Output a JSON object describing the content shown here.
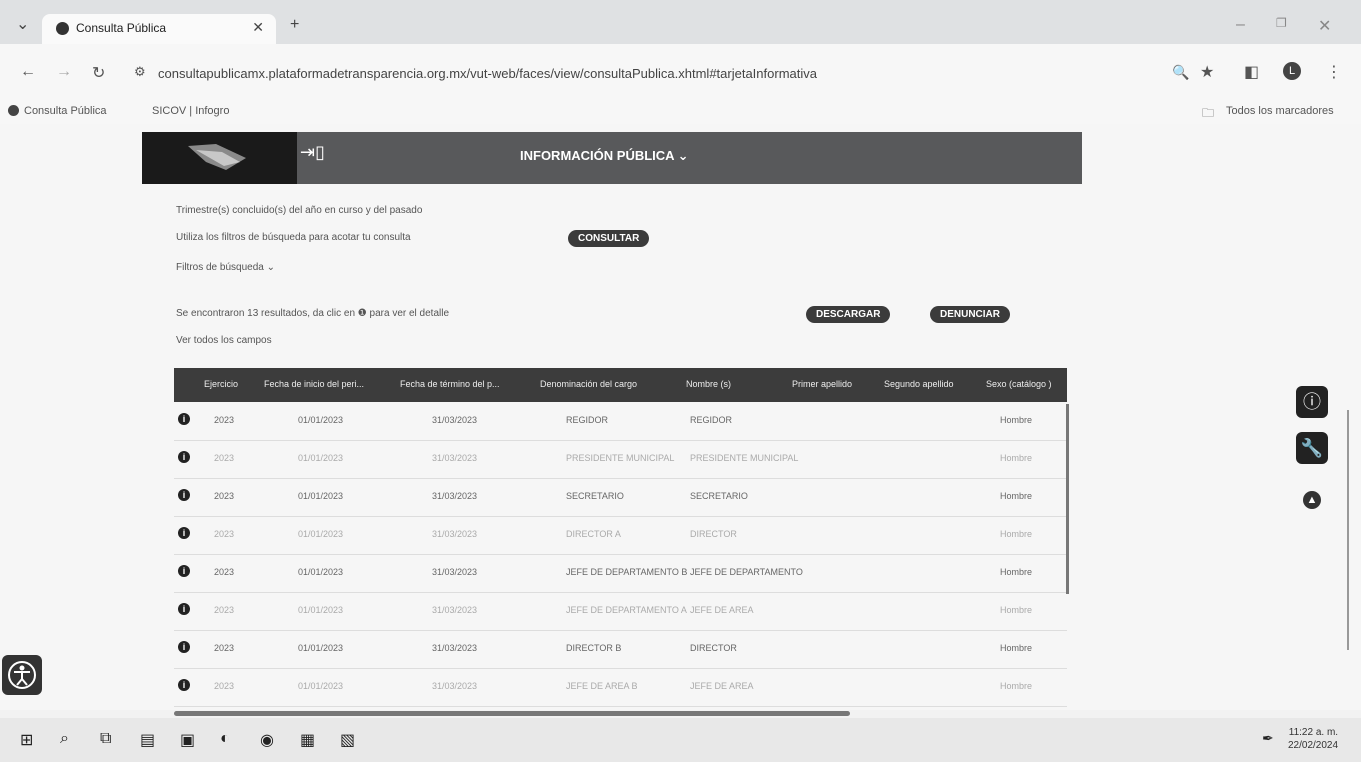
{
  "browser": {
    "tab_title": "Consulta Pública",
    "url": "consultapublicamx.plataformadetransparencia.org.mx/vut-web/faces/view/consultaPublica.xhtml#tarjetaInformativa",
    "bookmarks": [
      "Consulta Pública",
      "SICOV | Infogro"
    ],
    "all_bookmarks_label": "Todos los marcadores",
    "profile_initial": "L"
  },
  "header": {
    "title": "INFORMACIÓN PÚBLICA ⌄"
  },
  "intro": {
    "line1": "Trimestre(s) concluido(s) del año en curso y del pasado",
    "line2": "Utiliza los filtros de búsqueda para acotar tu consulta",
    "consult_button": "CONSULTAR",
    "filters_label": "Filtros de búsqueda ⌄",
    "results_text": "Se encontraron 13 resultados, da clic en ❶ para ver el detalle",
    "download_button": "DESCARGAR",
    "denounce_button": "DENUNCIAR",
    "see_all_fields": "Ver todos los campos"
  },
  "table": {
    "columns": [
      "Ejercicio",
      "Fecha de inicio del peri...",
      "Fecha de término del p...",
      "Denominación del cargo",
      "Nombre (s)",
      "Primer apellido",
      "Segundo apellido",
      "Sexo (catálogo )"
    ],
    "rows": [
      {
        "ejercicio": "2023",
        "inicio": "01/01/2023",
        "termino": "31/03/2023",
        "cargo": "REGIDOR",
        "nombre": "REGIDOR",
        "sexo": "Hombre"
      },
      {
        "ejercicio": "2023",
        "inicio": "01/01/2023",
        "termino": "31/03/2023",
        "cargo": "PRESIDENTE MUNICIPAL",
        "nombre": "PRESIDENTE MUNICIPAL",
        "sexo": "Hombre"
      },
      {
        "ejercicio": "2023",
        "inicio": "01/01/2023",
        "termino": "31/03/2023",
        "cargo": "SECRETARIO",
        "nombre": "SECRETARIO",
        "sexo": "Hombre"
      },
      {
        "ejercicio": "2023",
        "inicio": "01/01/2023",
        "termino": "31/03/2023",
        "cargo": "DIRECTOR A",
        "nombre": "DIRECTOR",
        "sexo": "Hombre"
      },
      {
        "ejercicio": "2023",
        "inicio": "01/01/2023",
        "termino": "31/03/2023",
        "cargo": "JEFE DE DEPARTAMENTO B",
        "nombre": "JEFE DE DEPARTAMENTO",
        "sexo": "Hombre"
      },
      {
        "ejercicio": "2023",
        "inicio": "01/01/2023",
        "termino": "31/03/2023",
        "cargo": "JEFE DE DEPARTAMENTO A",
        "nombre": "JEFE DE AREA",
        "sexo": "Hombre"
      },
      {
        "ejercicio": "2023",
        "inicio": "01/01/2023",
        "termino": "31/03/2023",
        "cargo": "DIRECTOR B",
        "nombre": "DIRECTOR",
        "sexo": "Hombre"
      },
      {
        "ejercicio": "2023",
        "inicio": "01/01/2023",
        "termino": "31/03/2023",
        "cargo": "JEFE DE AREA B",
        "nombre": "JEFE DE AREA",
        "sexo": "Hombre"
      }
    ]
  },
  "taskbar": {
    "time": "11:22 a. m.",
    "date": "22/02/2024"
  },
  "icons": {
    "info": "info-icon",
    "wrench": "wrench-icon",
    "location": "location-icon",
    "accessibility": "accessibility-icon"
  }
}
